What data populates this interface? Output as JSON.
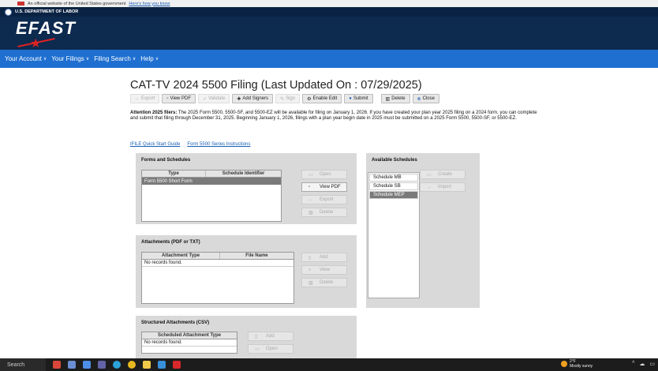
{
  "gov_banner": {
    "text": "An official website of the United States government",
    "link": "Here's how you know"
  },
  "header": {
    "agency": "U.S. DEPARTMENT OF LABOR",
    "logo": "EFAST"
  },
  "nav": {
    "items": [
      "Your Account",
      "Your Filings",
      "Filing Search",
      "Help"
    ]
  },
  "page_title": "CAT-TV 2024 5500 Filing (Last Updated On : 07/29/2025)",
  "toolbar": {
    "buttons": [
      {
        "label": "Export",
        "icon": "arrow-left-icon",
        "disabled": true
      },
      {
        "label": "View PDF",
        "icon": "document-icon",
        "disabled": false
      },
      {
        "label": "Validate",
        "icon": "check-icon",
        "disabled": true
      },
      {
        "label": "Add Signers",
        "icon": "plus-icon",
        "disabled": false
      },
      {
        "label": "Sign",
        "icon": "pen-icon",
        "disabled": true
      },
      {
        "label": "Enable Edit",
        "icon": "gear-icon",
        "disabled": false
      },
      {
        "label": "Submit",
        "icon": "submit-icon",
        "disabled": false
      },
      {
        "label": "Delete",
        "icon": "trash-icon",
        "disabled": false
      },
      {
        "label": "Close",
        "icon": "close-icon",
        "disabled": false
      }
    ]
  },
  "attention": {
    "lead": "Attention 2025 filers:",
    "body": " The 2025 Form 5500, 5500-SF, and 5500-EZ will be available for filing on January 1, 2026. If you have created your plan year 2025 filing on a 2024 form, you can complete and submit that filing through December 31, 2025. Beginning January 1, 2026, filings with a plan year begin date in 2025 must be submitted on a 2025 Form 5500, 5500-SF, or 5500-EZ."
  },
  "links": [
    "IFILE Quick Start Guide",
    "Form 5500 Series Instructions"
  ],
  "forms_panel": {
    "title": "Forms and Schedules",
    "columns": [
      "Type",
      "Schedule Identifier"
    ],
    "rows": [
      [
        "Form 5500 Short Form",
        ""
      ]
    ],
    "buttons": [
      "Open",
      "View PDF",
      "Export",
      "Delete"
    ]
  },
  "attachments_panel": {
    "title": "Attachments (PDF or TXT)",
    "columns": [
      "Attachment Type",
      "File Name"
    ],
    "empty": "No records found.",
    "buttons": [
      "Add",
      "View",
      "Delete"
    ]
  },
  "structured_panel": {
    "title": "Structured Attachments (CSV)",
    "columns": [
      "Scheduled Attachment Type"
    ],
    "empty": "No records found.",
    "buttons": [
      "Add",
      "Open"
    ]
  },
  "available_panel": {
    "title": "Available Schedules",
    "items": [
      "Schedule MB",
      "Schedule SB",
      "Schedule MEP"
    ],
    "buttons": [
      "Create",
      "Import"
    ]
  },
  "taskbar": {
    "search": "Search",
    "temp": "2°F",
    "weather": "Mostly sunny"
  },
  "colors": {
    "nav": "#1f6fd1",
    "header": "#0d2a4f"
  }
}
